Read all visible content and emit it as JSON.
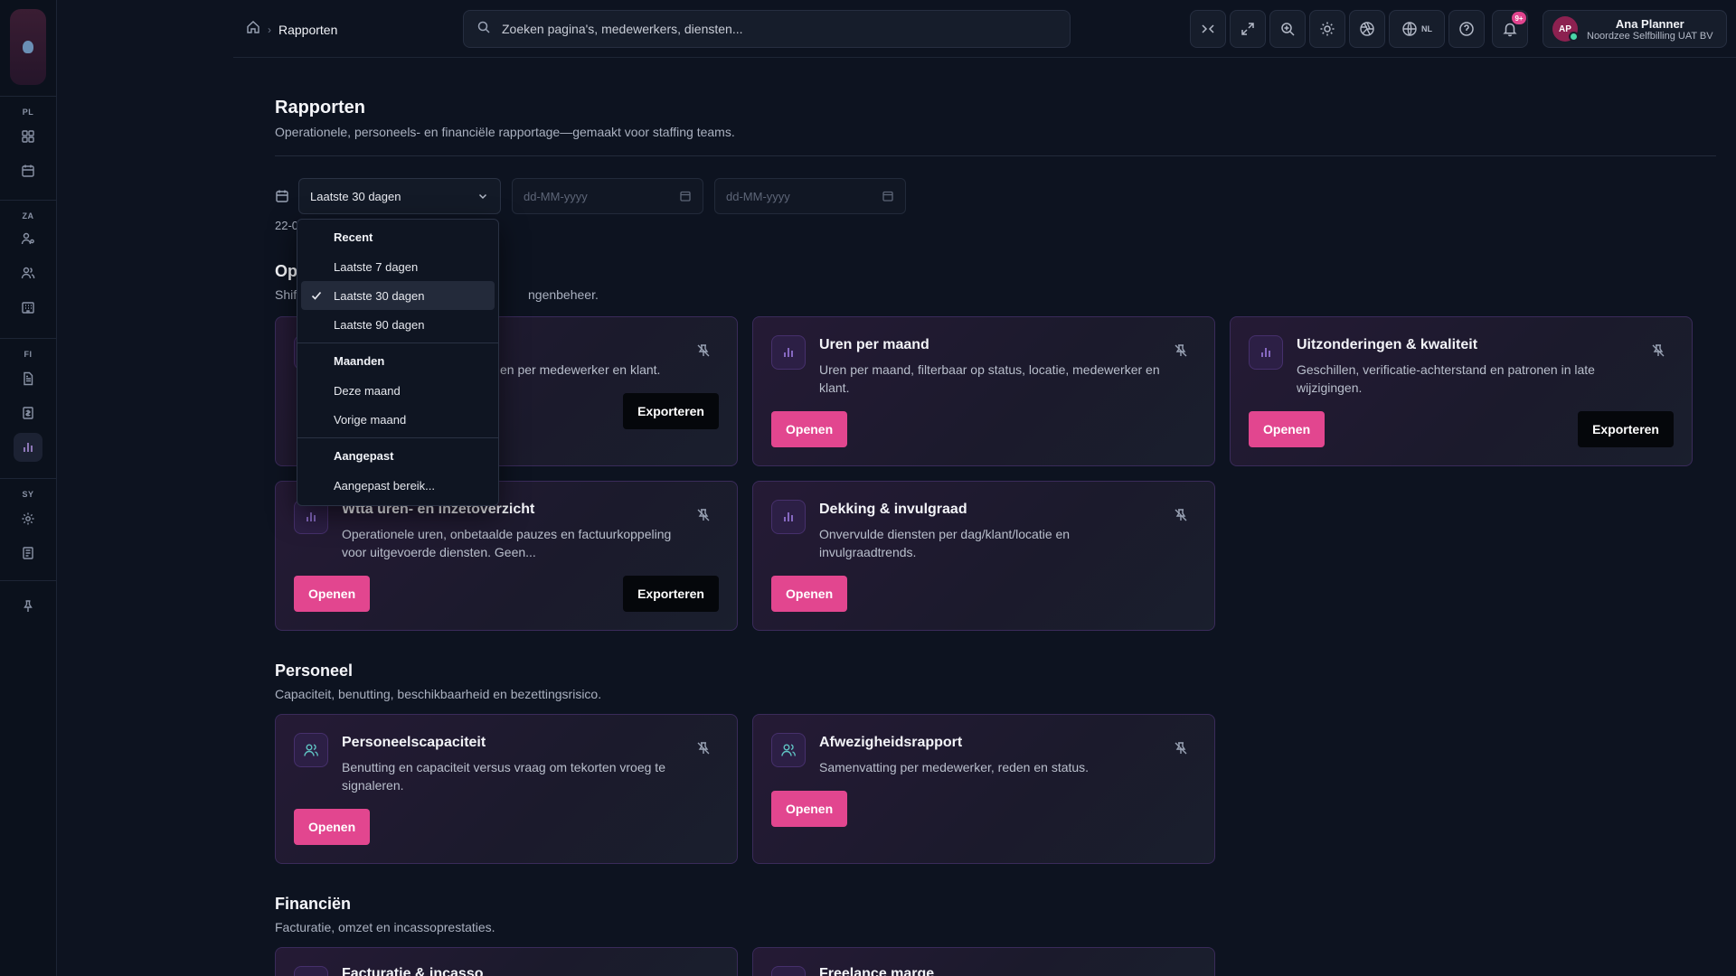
{
  "rail": {
    "sections": [
      {
        "label": "PL"
      },
      {
        "label": "ZA"
      },
      {
        "label": "FI"
      },
      {
        "label": "SY"
      }
    ]
  },
  "topbar": {
    "breadcrumb_current": "Rapporten",
    "search_placeholder": "Zoeken pagina's, medewerkers, diensten...",
    "language": "NL",
    "notification_count": "9+",
    "user": {
      "initials": "AP",
      "name": "Ana Planner",
      "org": "Noordzee Selfbilling UAT BV"
    }
  },
  "page": {
    "title": "Rapporten",
    "subtitle": "Operationele, personeels- en financiële rapportage—gemaakt voor staffing teams."
  },
  "filters": {
    "period_selected": "Laatste 30 dagen",
    "date_from_placeholder": "dd-MM-yyyy",
    "date_to_placeholder": "dd-MM-yyyy",
    "range_note": "22-0"
  },
  "dropdown": {
    "groups": [
      {
        "label": "Recent",
        "items": [
          "Laatste 7 dagen",
          "Laatste 30 dagen",
          "Laatste 90 dagen"
        ]
      },
      {
        "label": "Maanden",
        "items": [
          "Deze maand",
          "Vorige maand"
        ]
      },
      {
        "label": "Aangepast",
        "items": [
          "Aangepast bereik..."
        ]
      }
    ]
  },
  "sections": {
    "operational": {
      "title_partial": "Op",
      "subtitle_left": "Shif",
      "subtitle_right": "ngenbeheer."
    },
    "personnel": {
      "title": "Personeel",
      "subtitle": "Capaciteit, benutting, beschikbaarheid en bezettingsrisico."
    },
    "finance": {
      "title": "Financiën",
      "subtitle": "Facturatie, omzet en incassoprestaties."
    }
  },
  "cards": {
    "hidden_first": {
      "desc_tail": "en per medewerker en klant.",
      "export": "Exporteren"
    },
    "hours_month": {
      "title": "Uren per maand",
      "desc": "Uren per maand, filterbaar op status, locatie, medewerker en klant.",
      "open": "Openen"
    },
    "exceptions": {
      "title": "Uitzonderingen & kwaliteit",
      "desc": "Geschillen, verificatie-achterstand en patronen in late wijzigingen.",
      "open": "Openen",
      "export": "Exporteren"
    },
    "wtta": {
      "title": "Wtta uren- en inzetoverzicht",
      "desc": "Operationele uren, onbetaalde pauzes en factuurkoppeling voor uitgevoerde diensten. Geen...",
      "open": "Openen",
      "export": "Exporteren"
    },
    "coverage": {
      "title": "Dekking & invulgraad",
      "desc": "Onvervulde diensten per dag/klant/locatie en invulgraadtrends.",
      "open": "Openen"
    },
    "capacity": {
      "title": "Personeelscapaciteit",
      "desc": "Benutting en capaciteit versus vraag om tekorten vroeg te signaleren.",
      "open": "Openen"
    },
    "absence": {
      "title": "Afwezigheidsrapport",
      "desc": "Samenvatting per medewerker, reden en status.",
      "open": "Openen"
    },
    "billing": {
      "title": "Facturatie & incasso"
    },
    "freelance": {
      "title": "Freelance marge"
    }
  }
}
